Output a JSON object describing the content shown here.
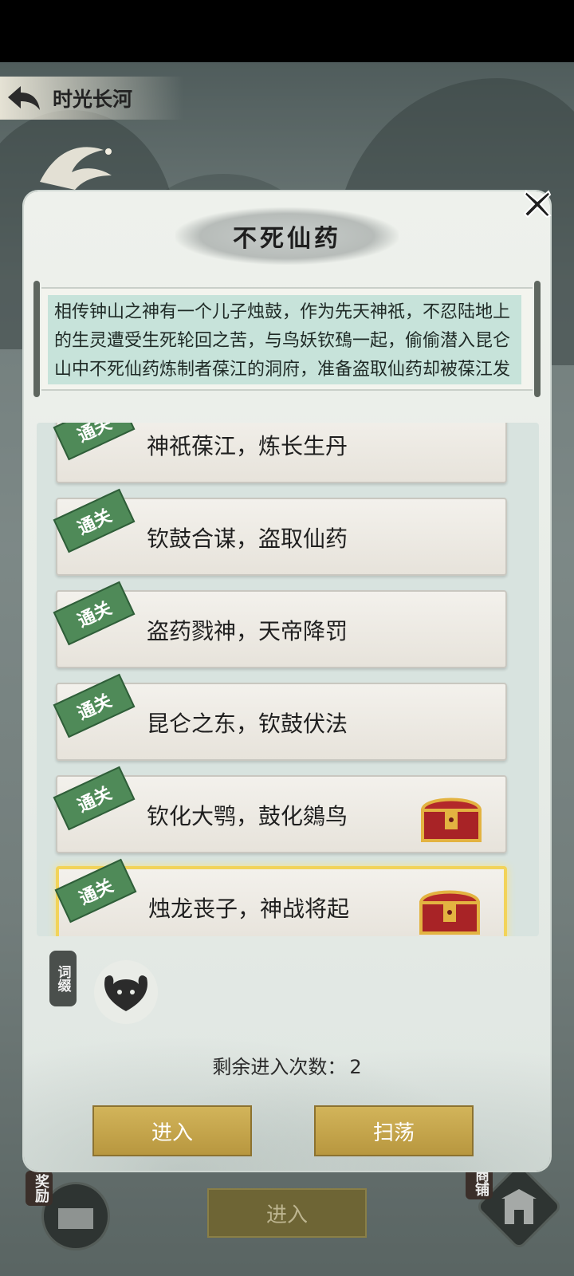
{
  "header": {
    "title": "时光长河"
  },
  "dialog": {
    "title": "不死仙药",
    "description": "相传钟山之神有一个儿子烛鼓，作为先天神祇，不忍陆地上的生灵遭受生死轮回之苦，与鸟妖钦䲹一起，偷偷潜入昆仑山中不死仙药炼制者葆江的洞府，准备盗取仙药却被葆江发现，作为烛龙之子的烛",
    "stages": [
      {
        "name": "神祇葆江，炼长生丹",
        "badge": "通关",
        "chest": false,
        "selected": false
      },
      {
        "name": "钦鼓合谋，盗取仙药",
        "badge": "通关",
        "chest": false,
        "selected": false
      },
      {
        "name": "盗药戮神，天帝降罚",
        "badge": "通关",
        "chest": false,
        "selected": false
      },
      {
        "name": "昆仑之东，钦鼓伏法",
        "badge": "通关",
        "chest": false,
        "selected": false
      },
      {
        "name": "钦化大鹗，鼓化鵕鸟",
        "badge": "通关",
        "chest": true,
        "selected": false
      },
      {
        "name": "烛龙丧子，神战将起",
        "badge": "通关",
        "chest": true,
        "selected": true
      }
    ],
    "affix_label": "词缀",
    "remaining_label": "剩余进入次数：",
    "remaining_count": "2",
    "enter_label": "进入",
    "sweep_label": "扫荡"
  },
  "bottom": {
    "enter_label": "进入",
    "reward_label": "奖励",
    "shop_label": "商铺"
  },
  "icons": [
    "back-arrow-icon",
    "crane-icon",
    "close-icon",
    "treasure-chest-icon",
    "affix-mask-icon",
    "gate-icon"
  ],
  "colors": {
    "accent_gold": "#c9a94d",
    "badge_green": "#4f8a58",
    "selected_border": "#f2d35a"
  }
}
